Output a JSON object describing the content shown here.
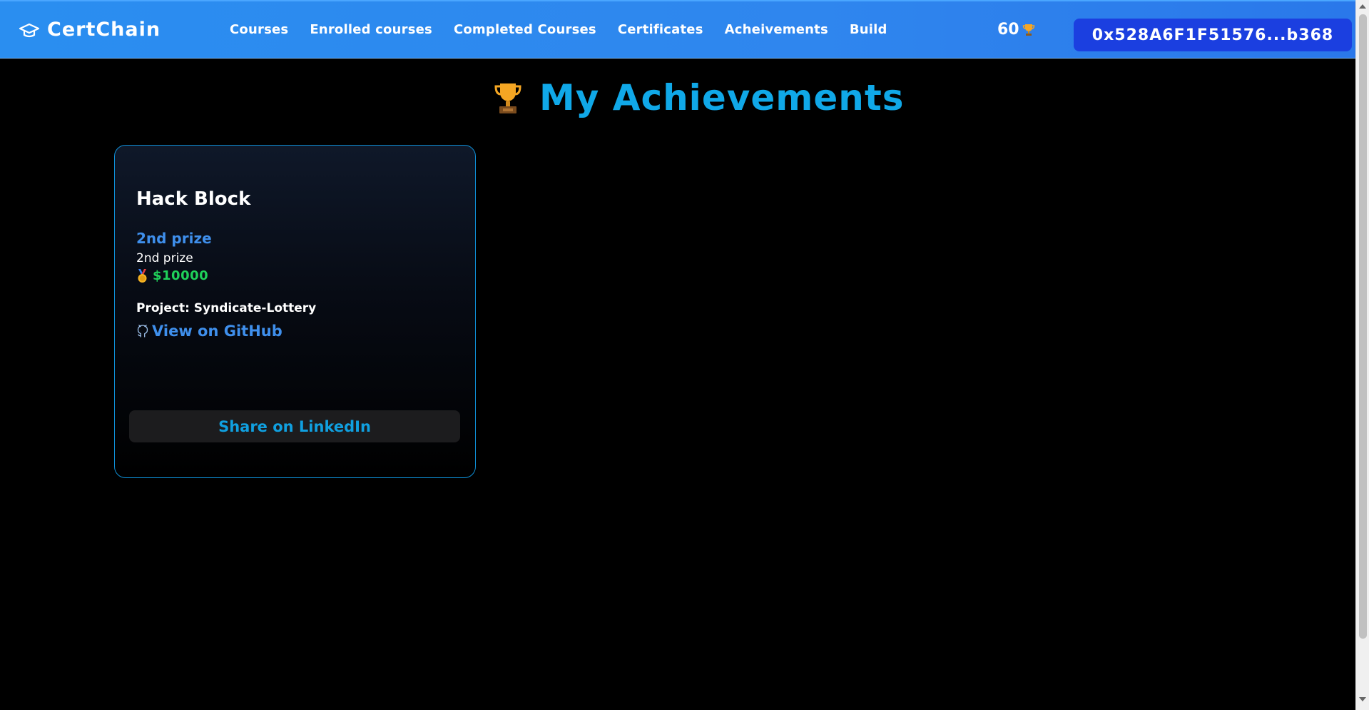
{
  "header": {
    "brand": "CertChain",
    "nav": [
      "Courses",
      "Enrolled courses",
      "Completed Courses",
      "Certificates",
      "Acheivements",
      "Build"
    ],
    "points": "60",
    "wallet_address": "0x528A6F1F51576...b368"
  },
  "page": {
    "title": "My Achievements"
  },
  "achievements": [
    {
      "event": "Hack Block",
      "prize": "2nd prize",
      "prize_description": "2nd prize",
      "reward": "$10000",
      "project_label": "Project: Syndicate-Lottery",
      "github_label": "View on GitHub",
      "share_label": "Share on LinkedIn"
    }
  ],
  "colors": {
    "accent": "#10a8e8",
    "link": "#3f8fec",
    "reward": "#1fd15a",
    "wallet_button": "#1b3fe0"
  }
}
